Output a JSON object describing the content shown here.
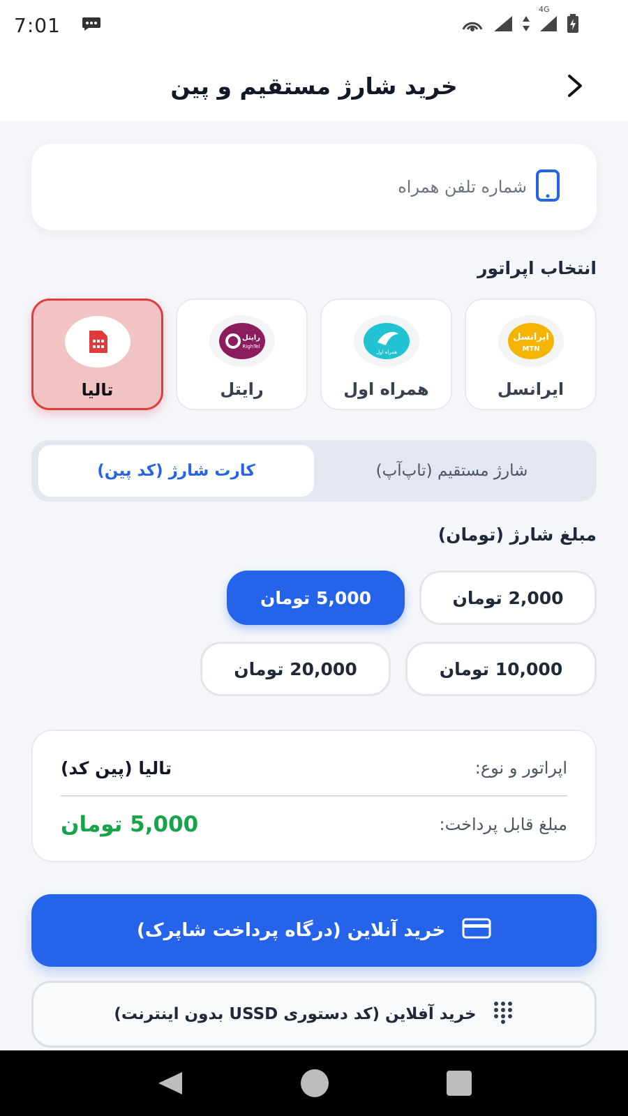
{
  "status_bar": {
    "time": "7:01",
    "icons": [
      "message-icon",
      "hotspot-icon",
      "signal-icon",
      "data-arrows-icon",
      "network-4g-icon",
      "signal-icon-2",
      "battery-charging-icon"
    ],
    "network_label": "4G"
  },
  "header": {
    "title": "خرید شارژ مستقیم و پین",
    "back_icon": "chevron-right-icon"
  },
  "phone": {
    "placeholder": "شماره تلفن همراه",
    "value": "",
    "icon": "smartphone-icon"
  },
  "operator_section": {
    "title": "انتخاب اپراتور",
    "operators": [
      {
        "name": "ایرانسل",
        "logo_text": "ایرانسل",
        "logo_sub": "MTN",
        "color": "#f5b400",
        "selected": false
      },
      {
        "name": "همراه اول",
        "logo_text": "همراه اول",
        "color": "#21c3d2",
        "selected": false
      },
      {
        "name": "رایتل",
        "logo_text": "رایتل",
        "logo_sub": "RighTel",
        "color": "#8b1d5f",
        "selected": false
      },
      {
        "name": "تالیا",
        "logo_icon": "sim-card-icon",
        "color": "#e23b3b",
        "selected": true
      }
    ]
  },
  "mode_toggle": {
    "options": [
      "شارژ مستقیم (تاپ‌آپ)",
      "کارت شارژ (کد پین)"
    ],
    "selected": "کارت شارژ (کد پین)"
  },
  "amount_section": {
    "title": "مبلغ شارژ (تومان)",
    "amounts": [
      "2,000 تومان",
      "5,000 تومان",
      "10,000 تومان",
      "20,000 تومان"
    ],
    "selected": "5,000 تومان"
  },
  "summary": {
    "operator_label": "اپراتور و نوع:",
    "operator_value": "تالیا (پین کد)",
    "amount_label": "مبلغ قابل پرداخت:",
    "amount_value": "5,000 تومان"
  },
  "actions": {
    "online_label": "خرید آنلاین (درگاه پرداخت شاپرک)",
    "online_icon": "credit-card-icon",
    "offline_label": "خرید آفلاین (کد دستوری USSD بدون اینترنت)",
    "offline_icon": "dialpad-icon"
  },
  "colors": {
    "primary": "#2563eb",
    "success": "#16a34a",
    "danger": "#e23b3b",
    "background": "#f4f6fa"
  },
  "nav_bar": {
    "buttons": [
      "back-triangle-icon",
      "home-circle-icon",
      "recents-square-icon"
    ]
  }
}
